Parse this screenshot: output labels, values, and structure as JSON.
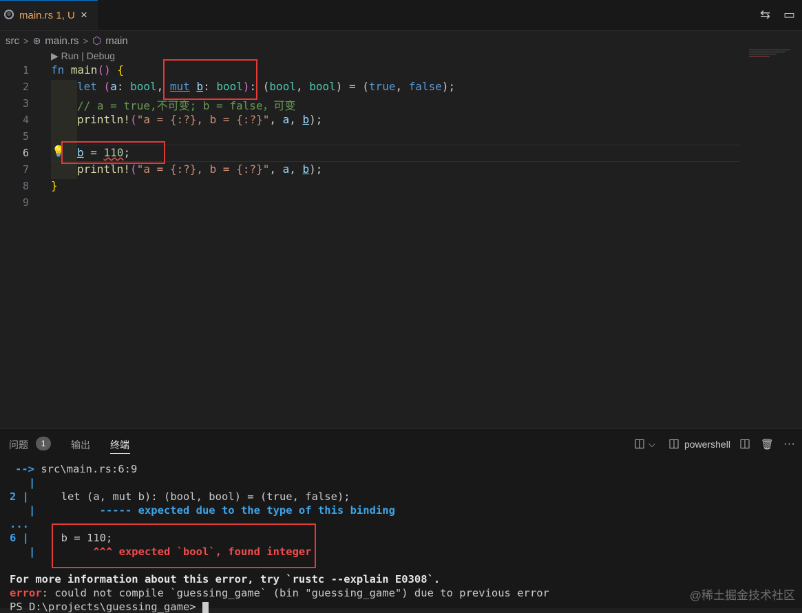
{
  "tab": {
    "filename": "main.rs",
    "status": "1, U",
    "close": "×",
    "rs_glyph": "®"
  },
  "toolbar": {
    "compare_icon": "⇆",
    "split_icon": "▭"
  },
  "breadcrumb": {
    "folder": "src",
    "file": "main.rs",
    "symbol": "main",
    "sep": ">"
  },
  "editor": {
    "codelens": "▶ Run | Debug",
    "line_numbers": [
      "1",
      "2",
      "3",
      "4",
      "5",
      "6",
      "7",
      "8",
      "9"
    ],
    "lines": {
      "l1": {
        "fn": "fn",
        "name": "main",
        "paren": "()",
        "open": "{"
      },
      "l2": {
        "let": "let",
        "p1": "(",
        "a": "a",
        "t1": ": ",
        "ty1": "bool",
        "c1": ", ",
        "mut": "mut",
        "sp": " ",
        "b": "b",
        "t2": ": ",
        "ty2": "bool",
        "p2": ")",
        "t3": ": (",
        "ty3": "bool",
        "c2": ", ",
        "ty4": "bool",
        "t4": ") = (",
        "tr": "true",
        "c3": ", ",
        "fa": "false",
        "t5": ");"
      },
      "l3": {
        "comment": "// a = true,不可变; b = false，可变"
      },
      "l4": {
        "macro": "println!",
        "p": "(",
        "str": "\"a = {:?}, b = {:?}\"",
        "args1": ", ",
        "a": "a",
        "c": ", ",
        "b": "b",
        "end": ");"
      },
      "l6": {
        "b": "b",
        "eq": " = ",
        "num": "110",
        "end": ";"
      },
      "l7": {
        "macro": "println!",
        "p": "(",
        "str": "\"a = {:?}, b = {:?}\"",
        "args1": ", ",
        "a": "a",
        "c": ", ",
        "b": "b",
        "end": ");"
      },
      "l8": {
        "close": "}"
      }
    }
  },
  "panel": {
    "tabs": {
      "problems": "问题",
      "problems_count": "1",
      "output": "输出",
      "terminal": "终端"
    },
    "shell_label": "powershell",
    "icons": {
      "layout": "◫",
      "chevron": "⌵",
      "split": "◫",
      "split2": "◫",
      "trash": "🗑",
      "more": "···"
    }
  },
  "terminal": {
    "t1_arrow": "-->",
    "t1_path": " src\\main.rs:6:9",
    "t2_bar": "   |",
    "t3_num": "2",
    "t3_bar": " |",
    "t3_code": "     let (a, mut b): (bool, bool) = (true, false);",
    "t4_bar": "   |",
    "t4_mark": "          ----- expected due to the type of this binding",
    "t5_dots": "...",
    "t6_num": "6",
    "t6_bar": " |",
    "t6_code": "     b = 110;",
    "t7_bar": "   |",
    "t7_mark": "         ^^^ expected `bool`, found integer",
    "t8": "For more information about this error, try `rustc --explain E0308`.",
    "t9_err": "error",
    "t9_rest": ": could not compile `guessing_game` (bin \"guessing_game\") due to previous error",
    "t10": "PS D:\\projects\\guessing_game> "
  },
  "watermark": "@稀土掘金技术社区",
  "colors": {
    "annotation_box": "#e53935",
    "error_red": "#f14c4c",
    "info_blue": "#3ea3e8"
  }
}
